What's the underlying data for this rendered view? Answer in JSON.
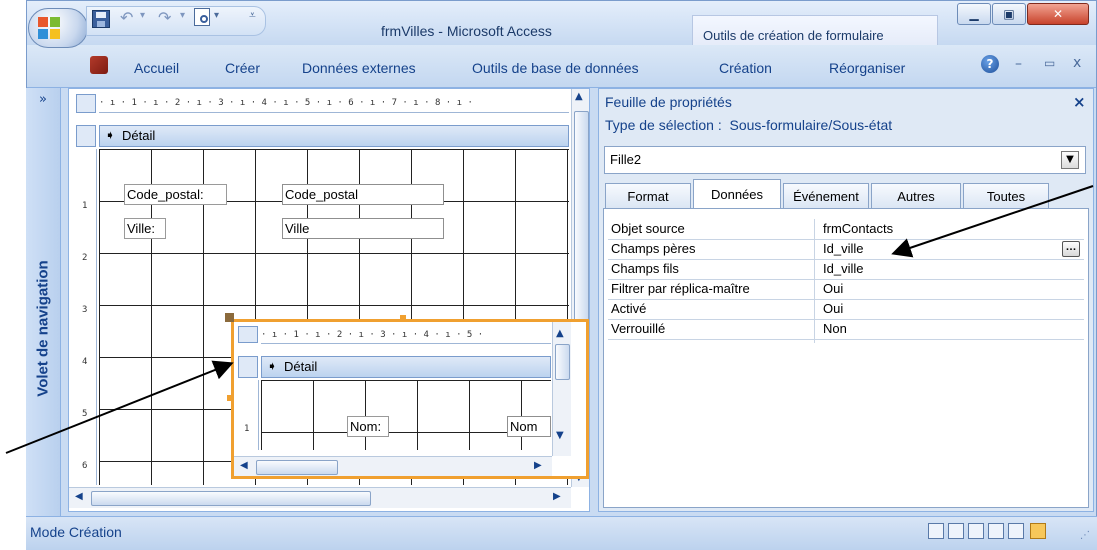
{
  "window": {
    "title": "frmVilles - Microsoft Access",
    "context_tab": "Outils de création de formulaire"
  },
  "ribbon": {
    "tabs": [
      "Accueil",
      "Créer",
      "Données externes",
      "Outils de base de données",
      "Création",
      "Réorganiser"
    ]
  },
  "nav_pane": {
    "collapse_glyph": "»",
    "label": "Volet de navigation"
  },
  "design": {
    "ruler_text": "· ı · 1 · ı · 2 · ı · 3 · ı · 4 · ı · 5 · ı · 6 · ı · 7 · ı · 8 · ı ·",
    "section_label": "Détail",
    "vruler": [
      "1",
      "2",
      "3",
      "4",
      "5",
      "6"
    ],
    "fields": [
      {
        "label": "Code_postal:",
        "value": "Code_postal"
      },
      {
        "label": "Ville:",
        "value": "Ville"
      }
    ],
    "subform": {
      "ruler_text": "· ı · 1 · ı · 2 · ı · 3 · ı · 4 · ı · 5 ·",
      "section_label": "Détail",
      "vruler": [
        "1"
      ],
      "field_label": "Nom:",
      "field_value": "Nom"
    }
  },
  "property_sheet": {
    "title": "Feuille de propriétés",
    "selection_type": "Type de sélection :  Sous-formulaire/Sous-état",
    "object_name": "Fille2",
    "tabs": [
      "Format",
      "Données",
      "Événement",
      "Autres",
      "Toutes"
    ],
    "active_tab": "Données",
    "properties": [
      {
        "name": "Objet source",
        "value": "frmContacts"
      },
      {
        "name": "Champs pères",
        "value": "Id_ville"
      },
      {
        "name": "Champs fils",
        "value": "Id_ville"
      },
      {
        "name": "Filtrer par réplica-maître",
        "value": "Oui"
      },
      {
        "name": "Activé",
        "value": "Oui"
      },
      {
        "name": "Verrouillé",
        "value": "Non"
      }
    ]
  },
  "status_bar": {
    "mode": "Mode Création"
  },
  "colors": {
    "accent_orange": "#f0a030",
    "chrome_blue": "#c9dbf2",
    "text_blue": "#15428b"
  }
}
